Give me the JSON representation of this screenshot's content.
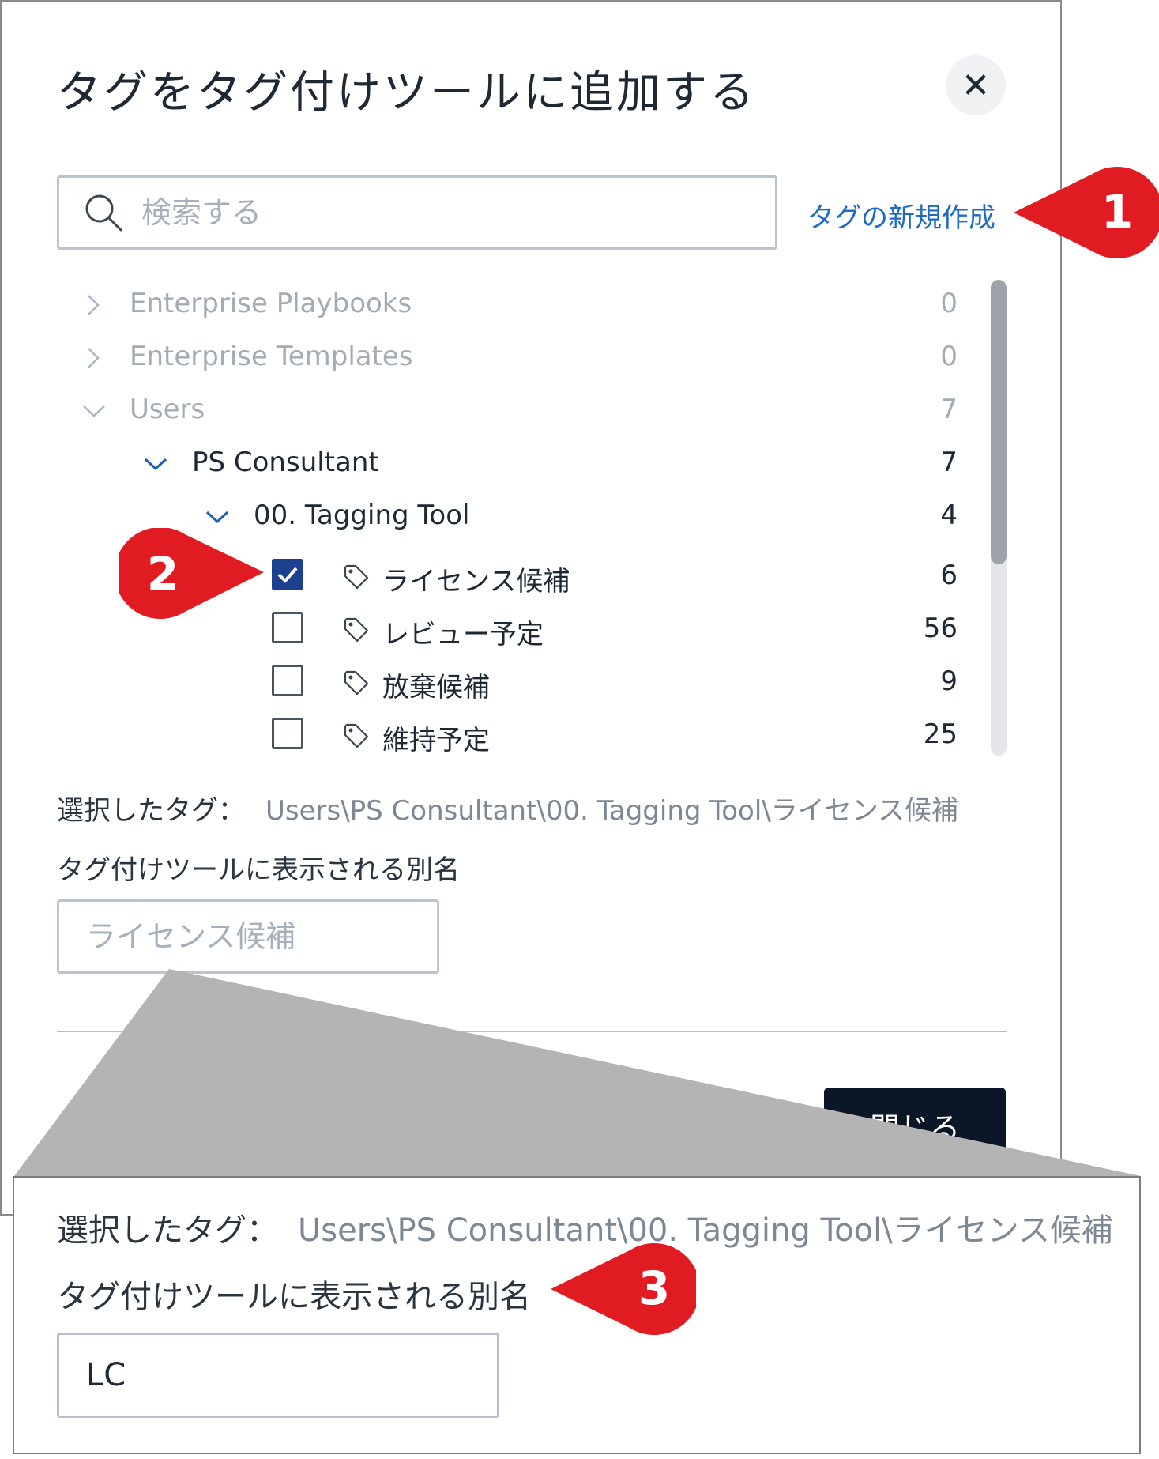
{
  "dialog": {
    "title": "タグをタグ付けツールに追加する",
    "close_icon": "close-icon",
    "search_placeholder": "検索する",
    "new_tag_link": "タグの新規作成"
  },
  "tree": [
    {
      "label": "Enterprise Playbooks",
      "count": "0",
      "state": "collapsed",
      "muted": true
    },
    {
      "label": "Enterprise Templates",
      "count": "0",
      "state": "collapsed",
      "muted": true
    },
    {
      "label": "Users",
      "count": "7",
      "state": "expanded",
      "muted": true
    },
    {
      "label": "PS Consultant",
      "count": "7",
      "state": "expanded",
      "muted": false
    },
    {
      "label": "00. Tagging Tool",
      "count": "4",
      "state": "expanded",
      "muted": false
    }
  ],
  "tags": [
    {
      "label": "ライセンス候補",
      "count": "6",
      "checked": true
    },
    {
      "label": "レビュー予定",
      "count": "56",
      "checked": false
    },
    {
      "label": "放棄候補",
      "count": "9",
      "checked": false
    },
    {
      "label": "維持予定",
      "count": "25",
      "checked": false
    }
  ],
  "selection": {
    "selected_label": "選択したタグ：",
    "selected_path": "Users\\PS Consultant\\00. Tagging Tool\\ライセンス候補",
    "alias_label": "タグ付けツールに表示される別名",
    "alias_placeholder": "ライセンス候補"
  },
  "footer": {
    "close_button": "閉じる"
  },
  "zoom": {
    "selected_label": "選択したタグ：",
    "selected_path": "Users\\PS Consultant\\00. Tagging Tool\\ライセンス候補",
    "alias_label": "タグ付けツールに表示される別名",
    "alias_value": "LC"
  },
  "callouts": [
    "1",
    "2",
    "3"
  ],
  "colors": {
    "callout_red": "#e01b22",
    "link_blue": "#1e6bc4",
    "checkbox_blue": "#1d3f8f",
    "button_dark": "#0b1626"
  }
}
